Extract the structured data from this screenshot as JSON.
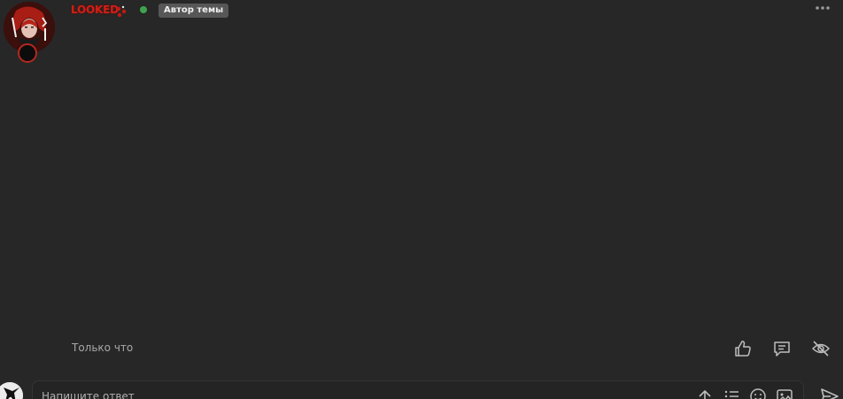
{
  "post": {
    "username": "LOOKED",
    "author_badge": "Автор темы",
    "timestamp": "Только что"
  },
  "reply_box": {
    "placeholder": "Напишите ответ"
  },
  "colors": {
    "background": "#272727",
    "username": "#d11f16",
    "online": "#3fa34d",
    "badge_bg": "#575757",
    "icon": "#bdbdbd"
  },
  "icons": {
    "more": "more-dots-icon",
    "like": "thumbs-up-icon",
    "reply": "comment-icon",
    "hide": "eye-off-icon",
    "upload": "upload-arrow-icon",
    "list": "list-icon",
    "smile": "smile-icon",
    "image": "image-icon",
    "send": "send-icon"
  }
}
